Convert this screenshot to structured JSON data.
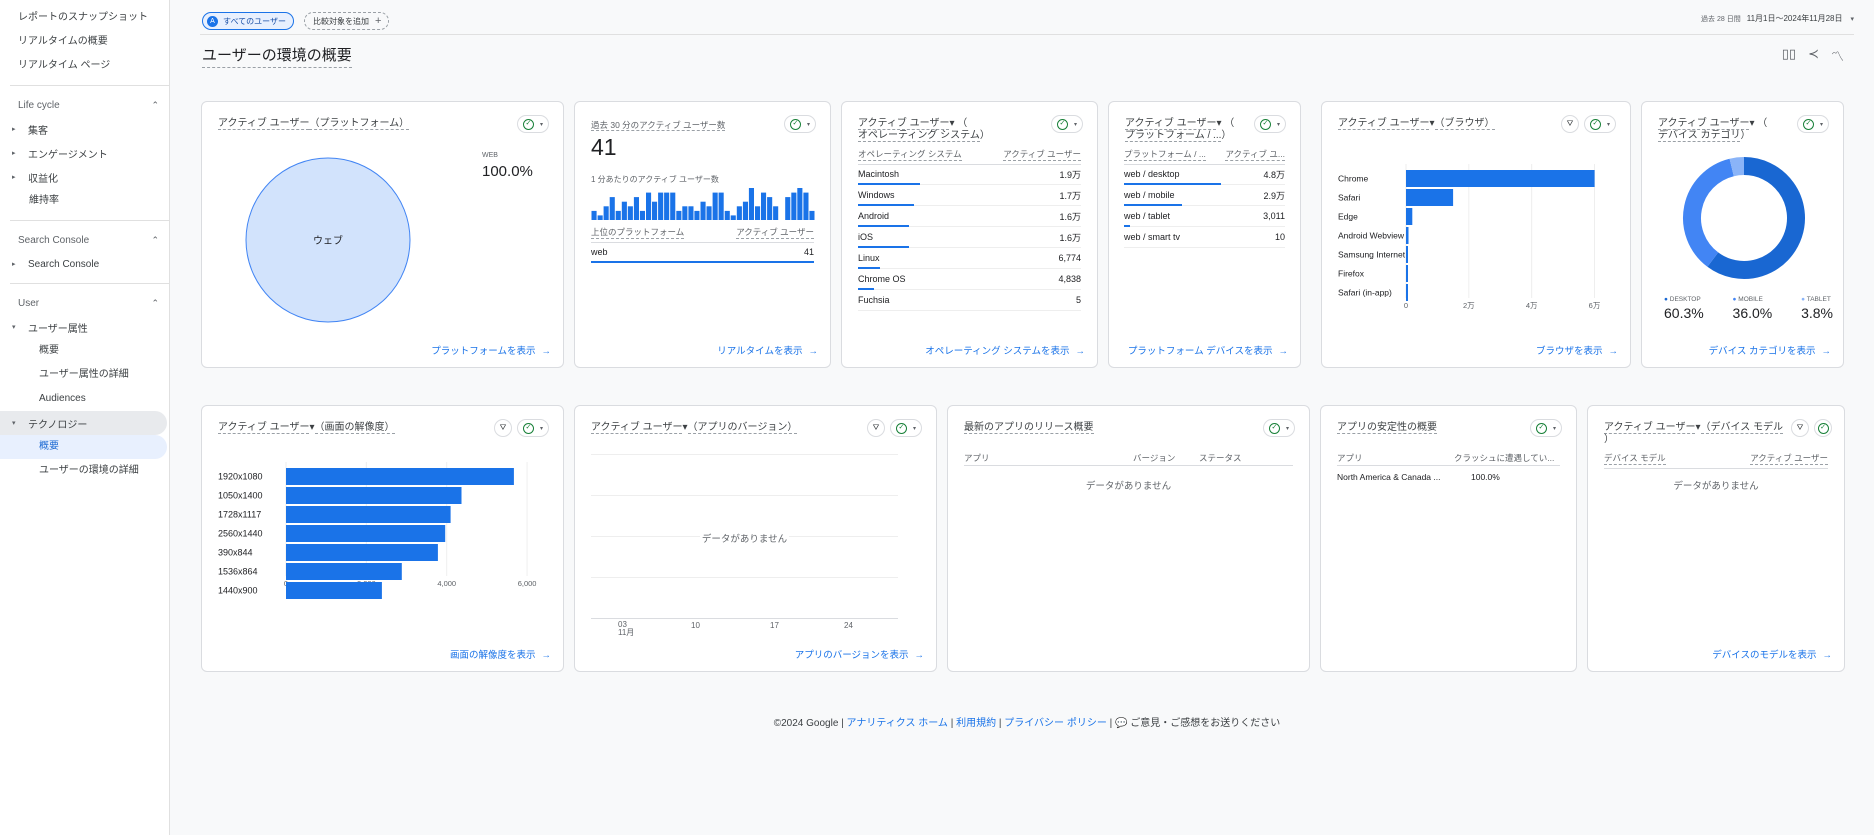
{
  "sidebar": {
    "top_links": [
      "レポートのスナップショット",
      "リアルタイムの概要",
      "リアルタイム ページ"
    ],
    "lifecycle": {
      "title": "Life cycle",
      "items": [
        "集客",
        "エンゲージメント",
        "収益化"
      ],
      "sub": "維持率"
    },
    "search_console": {
      "title": "Search Console",
      "items": [
        "Search Console"
      ]
    },
    "user": {
      "title": "User",
      "attr": "ユーザー属性",
      "attr_sub": [
        "概要",
        "ユーザー属性の詳細",
        "Audiences"
      ],
      "tech": "テクノロジー",
      "tech_sub": [
        "概要",
        "ユーザーの環境の詳細"
      ]
    }
  },
  "header": {
    "chip_users": "すべてのユーザー",
    "chip_users_icon": "A",
    "chip_add": "比較対象を追加",
    "date_label": "過去 28 日間",
    "date_range": "11月1日～2024年11月28日",
    "title": "ユーザーの環境の概要"
  },
  "icons": {
    "compare": "▯▯",
    "share": "≺",
    "insights": "〽",
    "ok": "✓",
    "dropdown": "▾",
    "filter": "⛛",
    "arrow": "→",
    "caret_right": "▸",
    "caret_down": "▾",
    "chev_up": "⌃",
    "feedback": "💬"
  },
  "cards": {
    "platform": {
      "title_a": "アクティブ ユーザー",
      "title_b": "（プラットフォーム）",
      "legend_label": "WEB",
      "legend_value": "100.0%",
      "slice_label": "ウェブ",
      "link": "プラットフォームを表示"
    },
    "realtime": {
      "title": "過去 30 分のアクティブ ユーザー数",
      "value": "41",
      "sub": "1 分あたりのアクティブ ユーザー数",
      "col1": "上位のプラットフォーム",
      "col2": "アクティブ ユーザー",
      "row_name": "web",
      "row_value": "41",
      "link": "リアルタイムを表示"
    },
    "os": {
      "title_a": "アクティブ ユーザー",
      "title_b": "（",
      "title_c": "オペレーティング システム",
      "title_d": "）",
      "col1": "オペレーティング システム",
      "col2": "アクティブ ユーザー",
      "rows": [
        {
          "name": "Macintosh",
          "value": "1.9万",
          "share": 0.28
        },
        {
          "name": "Windows",
          "value": "1.7万",
          "share": 0.25
        },
        {
          "name": "Android",
          "value": "1.6万",
          "share": 0.23
        },
        {
          "name": "iOS",
          "value": "1.6万",
          "share": 0.23
        },
        {
          "name": "Linux",
          "value": "6,774",
          "share": 0.1
        },
        {
          "name": "Chrome OS",
          "value": "4,838",
          "share": 0.07
        },
        {
          "name": "Fuchsia",
          "value": "5",
          "share": 0
        }
      ],
      "link": "オペレーティング システムを表示"
    },
    "platform_device": {
      "title_a": "アクティブ ユーザー",
      "title_b": "（",
      "title_c": "プラットフォーム / ...",
      "title_d": "）",
      "col1": "プラットフォーム / ...",
      "col2": "アクティブ ユ...",
      "rows": [
        {
          "name": "web / desktop",
          "value": "4.8万",
          "share": 0.6
        },
        {
          "name": "web / mobile",
          "value": "2.9万",
          "share": 0.36
        },
        {
          "name": "web / tablet",
          "value": "3,011",
          "share": 0.04
        },
        {
          "name": "web / smart tv",
          "value": "10",
          "share": 0
        }
      ],
      "link": "プラットフォーム デバイスを表示"
    },
    "browser": {
      "title_a": "アクティブ ユーザー",
      "title_b": "（ブラウザ）",
      "link": "ブラウザを表示"
    },
    "device_category": {
      "title_a": "アクティブ ユーザー",
      "title_b": "（",
      "title_c": "デバイス カテゴリ",
      "title_d": "）",
      "legend": [
        {
          "label": "DESKTOP",
          "value": "60.3%",
          "color": "#1967d2"
        },
        {
          "label": "MOBILE",
          "value": "36.0%",
          "color": "#4285f4"
        },
        {
          "label": "TABLET",
          "value": "3.8%",
          "color": "#8ab4f8"
        }
      ],
      "link": "デバイス カテゴリを表示"
    },
    "resolution": {
      "title_a": "アクティブ ユーザー",
      "title_b": "（画面の解像度）",
      "link": "画面の解像度を表示"
    },
    "app_version": {
      "title_a": "アクティブ ユーザー",
      "title_b": "（アプリのバージョン）",
      "no_data": "データがありません",
      "x_ticks": [
        "03",
        "10",
        "17",
        "24"
      ],
      "x_month": "11月",
      "link": "アプリのバージョンを表示"
    },
    "release": {
      "title": "最新のアプリのリリース概要",
      "cols": [
        "アプリ",
        "バージョン",
        "ステータス"
      ],
      "no_data": "データがありません"
    },
    "stability": {
      "title": "アプリの安定性の概要",
      "cols": [
        "アプリ",
        "クラッシュに遭遇してい..."
      ],
      "row_name": "North America & Canada ...",
      "row_value": "100.0%"
    },
    "device_model": {
      "title_a": "アクティブ ユーザー",
      "title_b": "（デバイス モデル",
      "title_c": "）",
      "cols": [
        "デバイス モデル",
        "アクティブ ユーザー"
      ],
      "no_data": "データがありません",
      "link": "デバイスのモデルを表示"
    }
  },
  "chart_data": [
    {
      "type": "pie",
      "title": "アクティブ ユーザー（プラットフォーム）",
      "categories": [
        "WEB"
      ],
      "values": [
        100.0
      ]
    },
    {
      "type": "bar",
      "title": "1 分あたりのアクティブ ユーザー数",
      "values": [
        2,
        1,
        3,
        5,
        2,
        4,
        3,
        5,
        2,
        6,
        4,
        6,
        6,
        6,
        2,
        3,
        3,
        2,
        4,
        3,
        6,
        6,
        2,
        1,
        3,
        4,
        7,
        3,
        6,
        5,
        3,
        0,
        5,
        6,
        7,
        6,
        2
      ]
    },
    {
      "type": "bar",
      "title": "アクティブ ユーザー（ブラウザ）",
      "orientation": "horizontal",
      "categories": [
        "Chrome",
        "Safari",
        "Edge",
        "Android Webview",
        "Samsung Internet",
        "Firefox",
        "Safari (in-app)"
      ],
      "values": [
        60000,
        15000,
        2000,
        800,
        600,
        500,
        300
      ],
      "x_ticks": [
        "0",
        "2万",
        "4万",
        "6万"
      ],
      "xlim": [
        0,
        63000
      ]
    },
    {
      "type": "pie",
      "title": "アクティブ ユーザー（デバイス カテゴリ）",
      "categories": [
        "DESKTOP",
        "MOBILE",
        "TABLET"
      ],
      "values": [
        60.3,
        36.0,
        3.8
      ]
    },
    {
      "type": "bar",
      "title": "アクティブ ユーザー（画面の解像度）",
      "orientation": "horizontal",
      "categories": [
        "1920x1080",
        "1050x1400",
        "1728x1117",
        "2560x1440",
        "390x844",
        "1536x864",
        "1440x900"
      ],
      "values": [
        6300,
        4850,
        4550,
        4400,
        4200,
        3200,
        2650
      ],
      "x_ticks": [
        "0",
        "2,000",
        "4,000",
        "6,000"
      ],
      "xlim": [
        0,
        6800
      ]
    }
  ],
  "footer": {
    "copyright": "©2024 Google",
    "links": [
      "アナリティクス ホーム",
      "利用規約",
      "プライバシー ポリシー"
    ],
    "feedback": "ご意見・ご感想をお送りください"
  }
}
